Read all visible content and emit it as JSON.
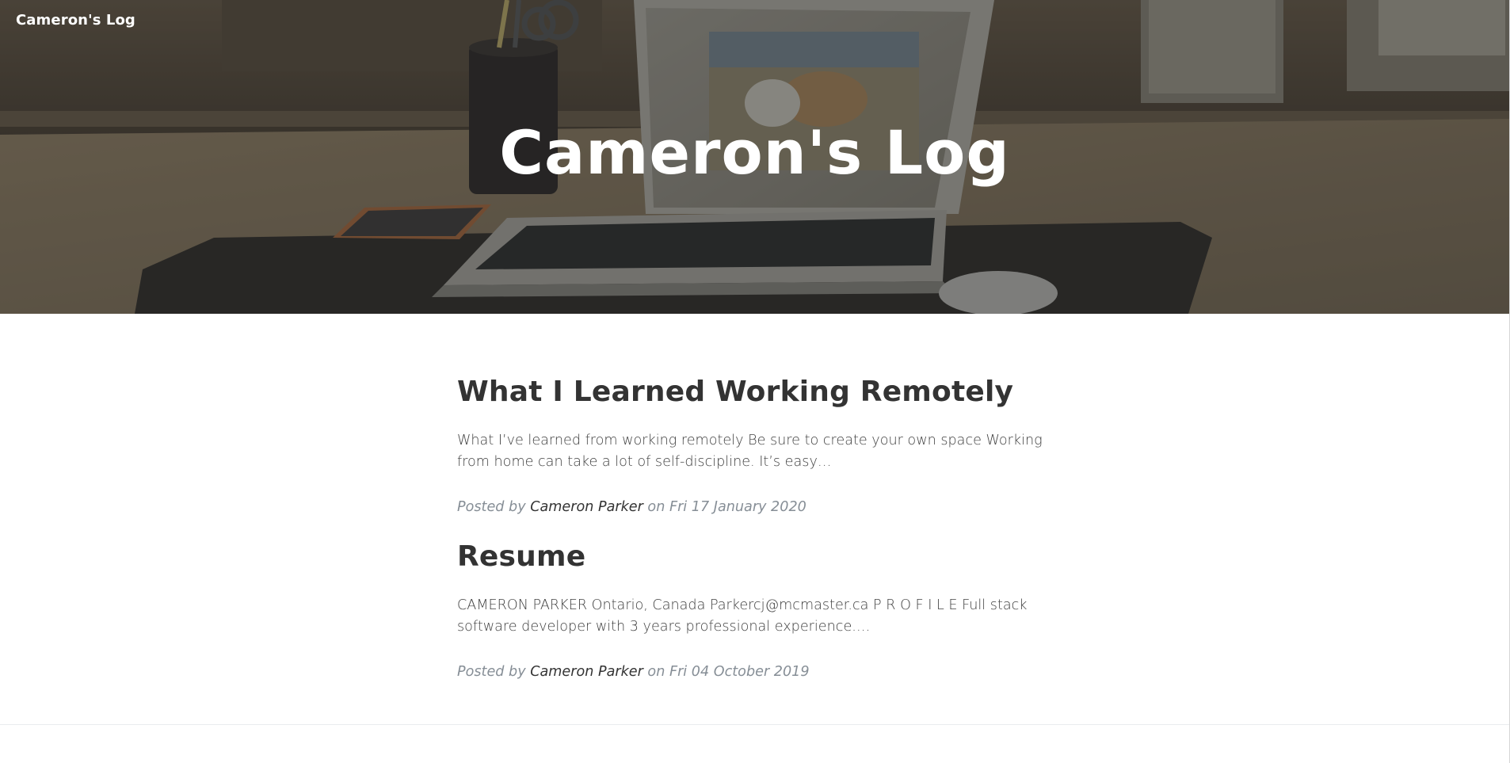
{
  "nav": {
    "brand": "Cameron's Log"
  },
  "hero": {
    "title": "Cameron's Log"
  },
  "posts": [
    {
      "title": "What I Learned Working Remotely",
      "excerpt": "What I’ve learned from working remotely Be sure to create your own space Working from home can take a lot of self-discipline. It’s easy…",
      "meta_prefix": "Posted by ",
      "author": "Cameron Parker",
      "meta_on": " on ",
      "date": "Fri 17 January 2020"
    },
    {
      "title": "Resume",
      "excerpt": "CAMERON PARKER Ontario, Canada Parkercj@mcmaster.ca P R O F I L E Full stack software developer with 3 years professional experience.…",
      "meta_prefix": "Posted by ",
      "author": "Cameron Parker",
      "meta_on": " on ",
      "date": "Fri 04 October 2019"
    }
  ],
  "colors": {
    "heading": "#333333",
    "body_text": "#404040",
    "meta": "#868e96",
    "hero_overlay": "#212529"
  }
}
